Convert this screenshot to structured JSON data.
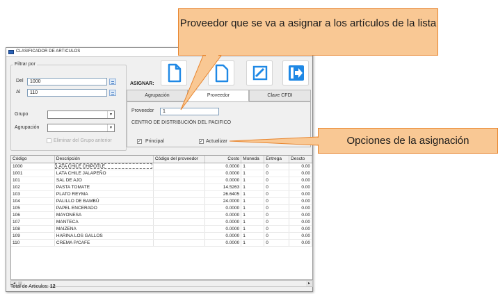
{
  "window": {
    "title": "CLASIFICADOR DE ARTICULOS"
  },
  "filter": {
    "legend": "Filtrar por",
    "del_label": "Del",
    "del_value": "1000",
    "al_label": "Al",
    "al_value": "110",
    "grupo_label": "Grupo",
    "grupo_value": "",
    "agrupacion_label": "Agrupación",
    "agrupacion_value": "",
    "checkbox_label": "Eliminar del Grupo anterior"
  },
  "assign": {
    "label": "ASIGNAR:",
    "toolbar_icons": [
      "new-document-icon",
      "save-icon",
      "edit-icon",
      "exit-icon"
    ],
    "tabs": [
      "Agrupación",
      "Proveedor",
      "Clave CFDI"
    ],
    "active_tab": "Proveedor",
    "proveedor_label": "Proveedor",
    "proveedor_value": "1",
    "proveedor_name": "CENTRO DE DISTRIBUCIÓN DEL PACIFICO",
    "principal_label": "Principal",
    "principal_checked": true,
    "actualizar_label": "Actualizar",
    "actualizar_checked": true
  },
  "grid": {
    "columns": [
      "Código",
      "Descripción",
      "Código del proveedor",
      "Costo",
      "Moneda",
      "Entrega",
      "Descto"
    ],
    "rows": [
      [
        "1000",
        "LATA CHILE CHIPOTLE",
        "",
        "0.0000",
        "1",
        "0",
        "0.00"
      ],
      [
        "1001",
        "LATA CHILE JALAPEÑO",
        "",
        "0.0000",
        "1",
        "0",
        "0.00"
      ],
      [
        "101",
        "SAL DE AJO",
        "",
        "0.0000",
        "1",
        "0",
        "0.00"
      ],
      [
        "102",
        "PASTA TOMATE",
        "",
        "14.5263",
        "1",
        "0",
        "0.00"
      ],
      [
        "103",
        "PLATO REYMA",
        "",
        "26.6405",
        "1",
        "0",
        "0.00"
      ],
      [
        "104",
        "PALILLO DE BAMBÚ",
        "",
        "24.0000",
        "1",
        "0",
        "0.00"
      ],
      [
        "105",
        "PAPEL ENCERADO",
        "",
        "0.0000",
        "1",
        "0",
        "0.00"
      ],
      [
        "106",
        "MAYONESA",
        "",
        "0.0000",
        "1",
        "0",
        "0.00"
      ],
      [
        "107",
        "MANTECA",
        "",
        "0.0000",
        "1",
        "0",
        "0.00"
      ],
      [
        "108",
        "MAIZENA",
        "",
        "0.0000",
        "1",
        "0",
        "0.00"
      ],
      [
        "109",
        "HARINA LOS GALLOS",
        "",
        "0.0000",
        "1",
        "0",
        "0.00"
      ],
      [
        "110",
        "CREMA P/CAFE",
        "",
        "0.0000",
        "1",
        "0",
        "0.00"
      ]
    ]
  },
  "footer": {
    "total_label": "Total de Articulos:",
    "total_value": "12"
  },
  "callouts": {
    "proveedor": "Proveedor que se va a asignar a los artículos de la lista",
    "opciones": "Opciones de la asignación"
  },
  "colors": {
    "callout_fill": "#f9c894",
    "callout_border": "#e8852e",
    "icon_blue": "#1e88e5"
  }
}
